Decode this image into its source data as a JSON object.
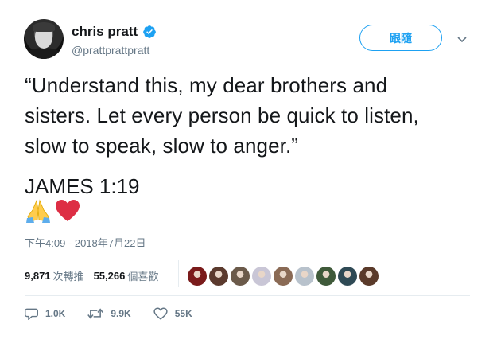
{
  "author": {
    "display_name": "chris pratt",
    "handle": "@prattprattpratt",
    "verified": true,
    "avatar_icon": "profile-photo"
  },
  "header": {
    "follow_label": "跟隨",
    "more_icon": "chevron-down-icon"
  },
  "tweet": {
    "lines": [
      "“Understand this, my dear brothers and",
      "sisters. Let every person be quick to listen,",
      "slow to speak, slow to anger.”"
    ],
    "verse": "JAMES 1:19",
    "emojis": [
      "🙏",
      "❤"
    ],
    "timestamp": "下午4:09 - 2018年7月22日"
  },
  "stats": {
    "retweets_count": "9,871",
    "retweets_label": "次轉推",
    "likes_count": "55,266",
    "likes_label": "個喜歡"
  },
  "liker_avatars": [
    "#7a1b1b",
    "#5b3a2e",
    "#6b5a4a",
    "#c9c6d6",
    "#8a6a55",
    "#b8c2cc",
    "#3f5a3a",
    "#2f4a55",
    "#5a3a2a"
  ],
  "actions": {
    "reply_count": "1.0K",
    "retweet_count": "9.9K",
    "like_count": "55K"
  },
  "colors": {
    "accent": "#1da1f2",
    "text": "#14171a",
    "muted": "#657786",
    "divider": "#e6ecf0",
    "heart": "#e0245e"
  }
}
